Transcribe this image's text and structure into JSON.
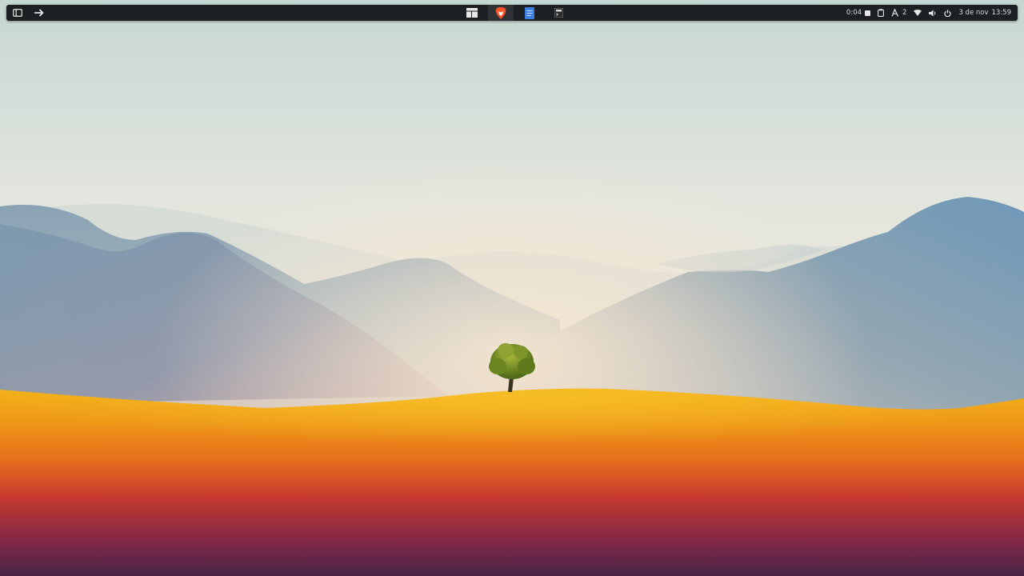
{
  "panel": {
    "left": {
      "sidebar_toggle_icon": "sidebar-panel-icon",
      "arrow_icon": "arrow-right-icon"
    },
    "apps": [
      {
        "name": "layout-manager",
        "icon": "window-layout-icon"
      },
      {
        "name": "brave-browser",
        "icon": "brave-lion-icon",
        "color": "#fb542b"
      },
      {
        "name": "text-editor",
        "icon": "document-icon",
        "color": "#3d7fe0"
      },
      {
        "name": "terminal",
        "icon": "terminal-icon"
      }
    ],
    "tray": {
      "timer": "0:04",
      "notifications_count": "2",
      "date": "3 de nov",
      "time": "13:59"
    }
  },
  "wallpaper": {
    "description_colors": {
      "sky_top": "#c9d8d4",
      "mountains": "#7e9cb0",
      "dune_top": "#f0a91a",
      "dune_mid": "#e8721c",
      "dune_bottom": "#5a2346",
      "tree": "#6d8a1e"
    }
  }
}
